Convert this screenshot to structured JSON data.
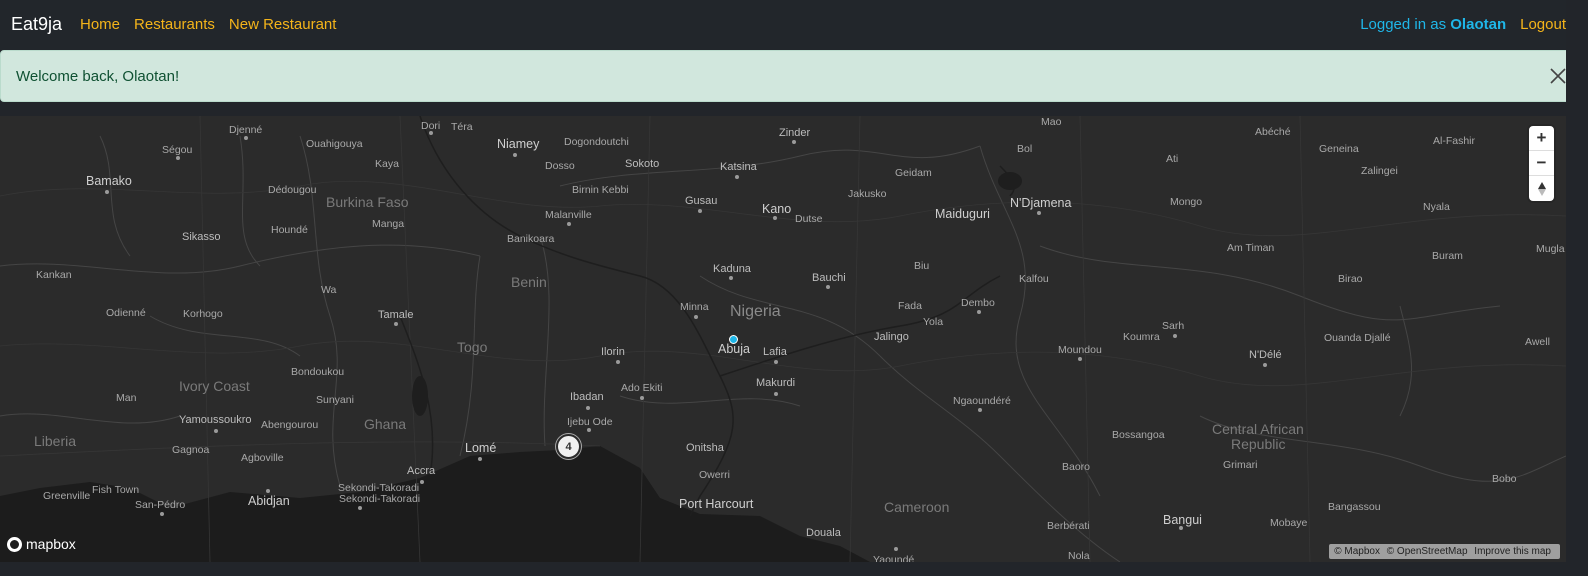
{
  "navbar": {
    "brand": "Eat9ja",
    "links": [
      "Home",
      "Restaurants",
      "New Restaurant"
    ],
    "logged_in_prefix": "Logged in as",
    "username": "Olaotan",
    "logout": "Logout"
  },
  "alert": {
    "message": "Welcome back, Olaotan!"
  },
  "map": {
    "cluster_count": "4",
    "controls": {
      "zoom_in": "+",
      "zoom_out": "−",
      "compass": "▲"
    },
    "logo_text": "mapbox",
    "attribution": [
      "© Mapbox",
      "© OpenStreetMap",
      "Improve this map"
    ],
    "countries": [
      "Burkina Faso",
      "Benin",
      "Nigeria",
      "Togo",
      "Ivory Coast",
      "Ghana",
      "Liberia",
      "Cameroon",
      "Central African",
      "Republic"
    ],
    "cities": [
      "Djenné",
      "Dori",
      "Téra",
      "Mao",
      "Abéché",
      "Ségou",
      "Ouahigouya",
      "Niamey",
      "Dogondoutchi",
      "Zinder",
      "Bol",
      "Geneina",
      "Al-Fashir",
      "Bamako",
      "Kaya",
      "Dosso",
      "Sokoto",
      "Katsina",
      "Geidam",
      "Ati",
      "Zalingei",
      "Dédougou",
      "Birnin Kebbi",
      "Gusau",
      "Jakusko",
      "N'Djamena",
      "Mongo",
      "Nyala",
      "Malanville",
      "Kano",
      "Dutse",
      "Maiduguri",
      "Sikasso",
      "Houndé",
      "Manga",
      "Banikoara",
      "Am Timan",
      "Buram",
      "Mugla",
      "Kankan",
      "Kaduna",
      "Biu",
      "Bauchi",
      "Kalfou",
      "Birao",
      "Wa",
      "Minna",
      "Fada",
      "Dembo",
      "Odienné",
      "Korhogo",
      "Tamale",
      "Yola",
      "Jalingo",
      "Sarh",
      "Koumra",
      "Ouanda Djallé",
      "Awell",
      "Abuja",
      "Lafia",
      "Ilorin",
      "Moundou",
      "N'Délé",
      "Bondoukou",
      "Makurdi",
      "Ado Ekiti",
      "Man",
      "Sunyani",
      "Ibadan",
      "Ngaoundéré",
      "Yamoussoukro",
      "Abengourou",
      "Ijebu Ode",
      "Bossangoa",
      "Onitsha",
      "Gagnoa",
      "Agboville",
      "Lomé",
      "Owerri",
      "Baoro",
      "Grimari",
      "Accra",
      "Fish Town",
      "Sekondi-Takoradi",
      "Abidjan",
      "Bobo",
      "Greenville",
      "San-Pédro",
      "Port Harcourt",
      "Cameroon",
      "Bangassou",
      "Douala",
      "Berbérati",
      "Bangui",
      "Mobaye",
      "Nola",
      "Yaoundé"
    ]
  },
  "colors": {
    "navbar_bg": "#22262b",
    "accent": "#f4b41a",
    "user_link": "#1fb6e8",
    "alert_bg": "#d1e7dd",
    "map_bg": "#2b2b2b"
  }
}
